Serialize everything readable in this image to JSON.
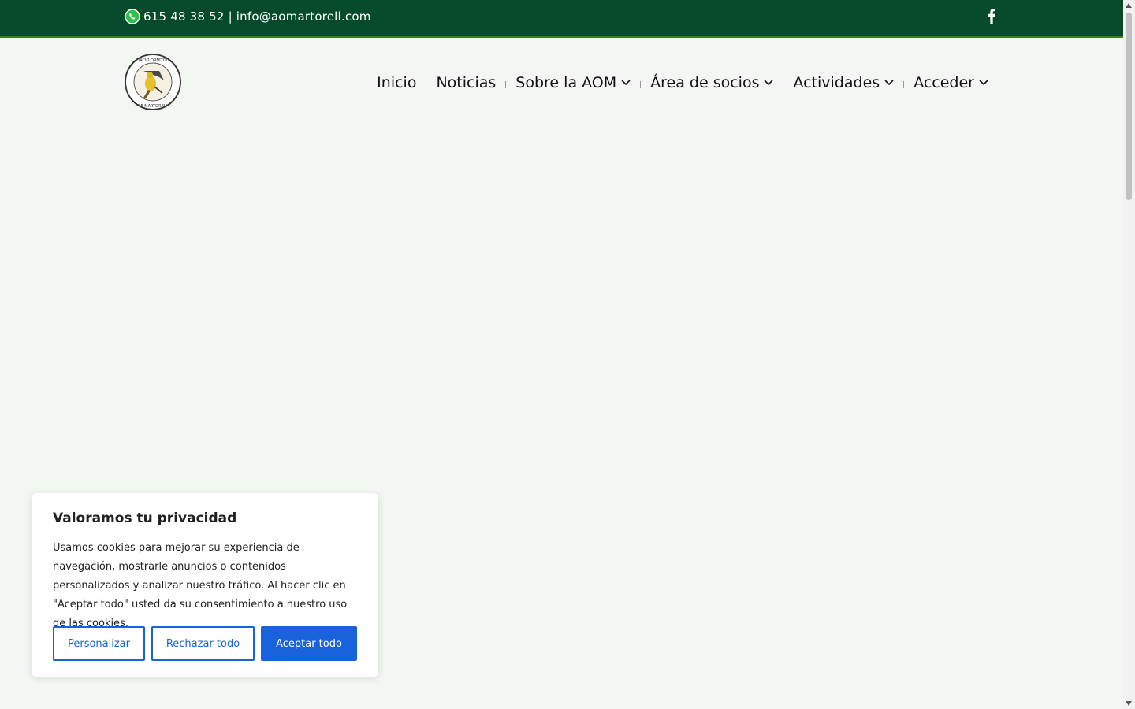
{
  "topbar": {
    "contact": "615 48 38 52 | info@aomartorell.com",
    "icons": [
      "whatsapp-icon",
      "facebook-icon"
    ]
  },
  "header": {
    "logo_text": [
      "ASSOCIACIÓ ORNITOLÒGICA",
      "DE MARTORELL"
    ],
    "nav": [
      {
        "label": "Inicio",
        "has_dropdown": false
      },
      {
        "label": "Noticias",
        "has_dropdown": false
      },
      {
        "label": "Sobre la AOM",
        "has_dropdown": true
      },
      {
        "label": "Área de socios",
        "has_dropdown": true
      },
      {
        "label": "Actividades",
        "has_dropdown": true
      },
      {
        "label": "Acceder",
        "has_dropdown": true
      }
    ]
  },
  "cookie": {
    "title": "Valoramos tu privacidad",
    "text": "Usamos cookies para mejorar su experiencia de navegación, mostrarle anuncios o contenidos personalizados y analizar nuestro tráfico. Al hacer clic en \"Aceptar todo\" usted da su consentimiento a nuestro uso de las cookies.",
    "buttons": {
      "customize": "Personalizar",
      "reject": "Rechazar todo",
      "accept": "Aceptar todo"
    }
  },
  "colors": {
    "topbar": "#054b2b",
    "accent": "#1863dc",
    "background": "#f3f7f2"
  }
}
